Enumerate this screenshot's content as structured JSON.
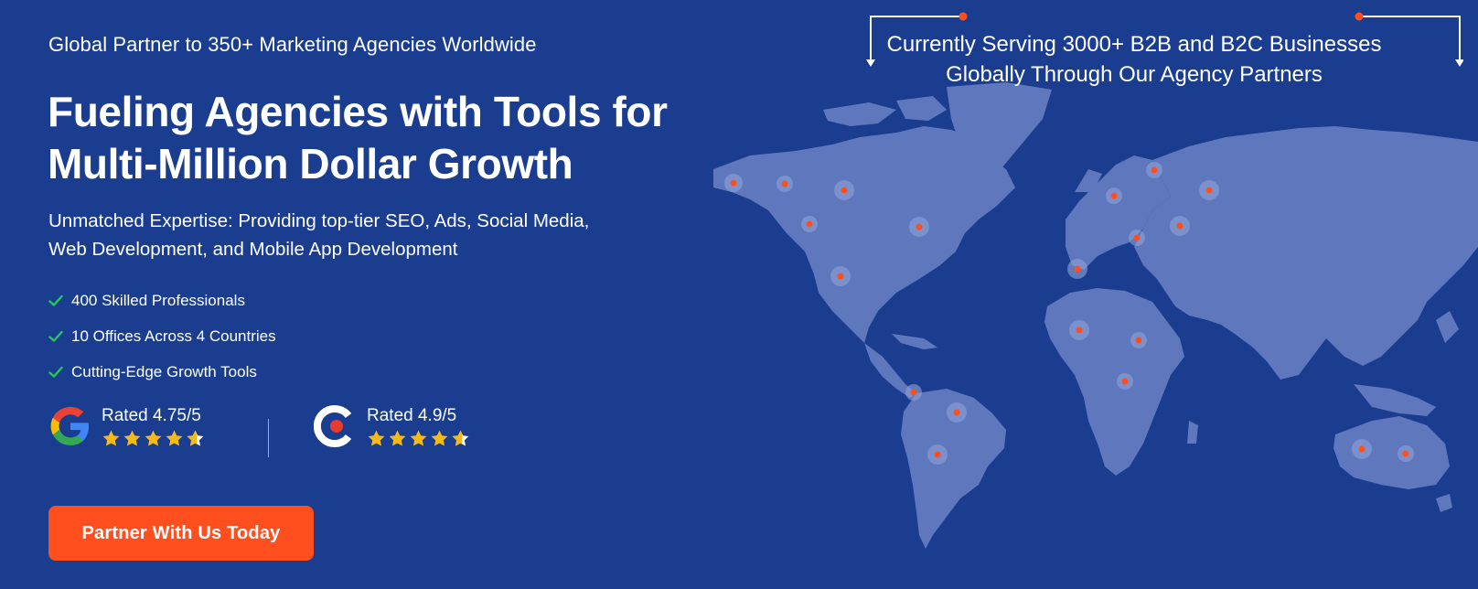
{
  "tagline": "Global Partner to 350+ Marketing Agencies Worldwide",
  "headline": {
    "line1": "Fueling Agencies with Tools for",
    "line2": "Multi-Million Dollar Growth"
  },
  "subtext": {
    "line1": "Unmatched Expertise: Providing top-tier SEO, Ads, Social Media,",
    "line2": "Web Development, and Mobile App Development"
  },
  "features": [
    "400 Skilled Professionals",
    "10 Offices Across 4 Countries",
    "Cutting-Edge Growth Tools"
  ],
  "ratings": [
    {
      "icon": "google-logo-icon",
      "label": "Rated 4.75/5",
      "stars": 4.75
    },
    {
      "icon": "clutch-logo-icon",
      "label": "Rated 4.9/5",
      "stars": 4.9
    }
  ],
  "cta_label": "Partner With Us Today",
  "serving": {
    "line1": "Currently Serving 3000+ B2B and B2C Businesses",
    "line2": "Globally Through Our Agency Partners"
  },
  "colors": {
    "background": "#1a3d8f",
    "accent": "#ff4f1f",
    "check": "#27c85a",
    "star": "#f5b919",
    "map_land": "#5f78bd",
    "map_dot": "#ff4f1f"
  }
}
